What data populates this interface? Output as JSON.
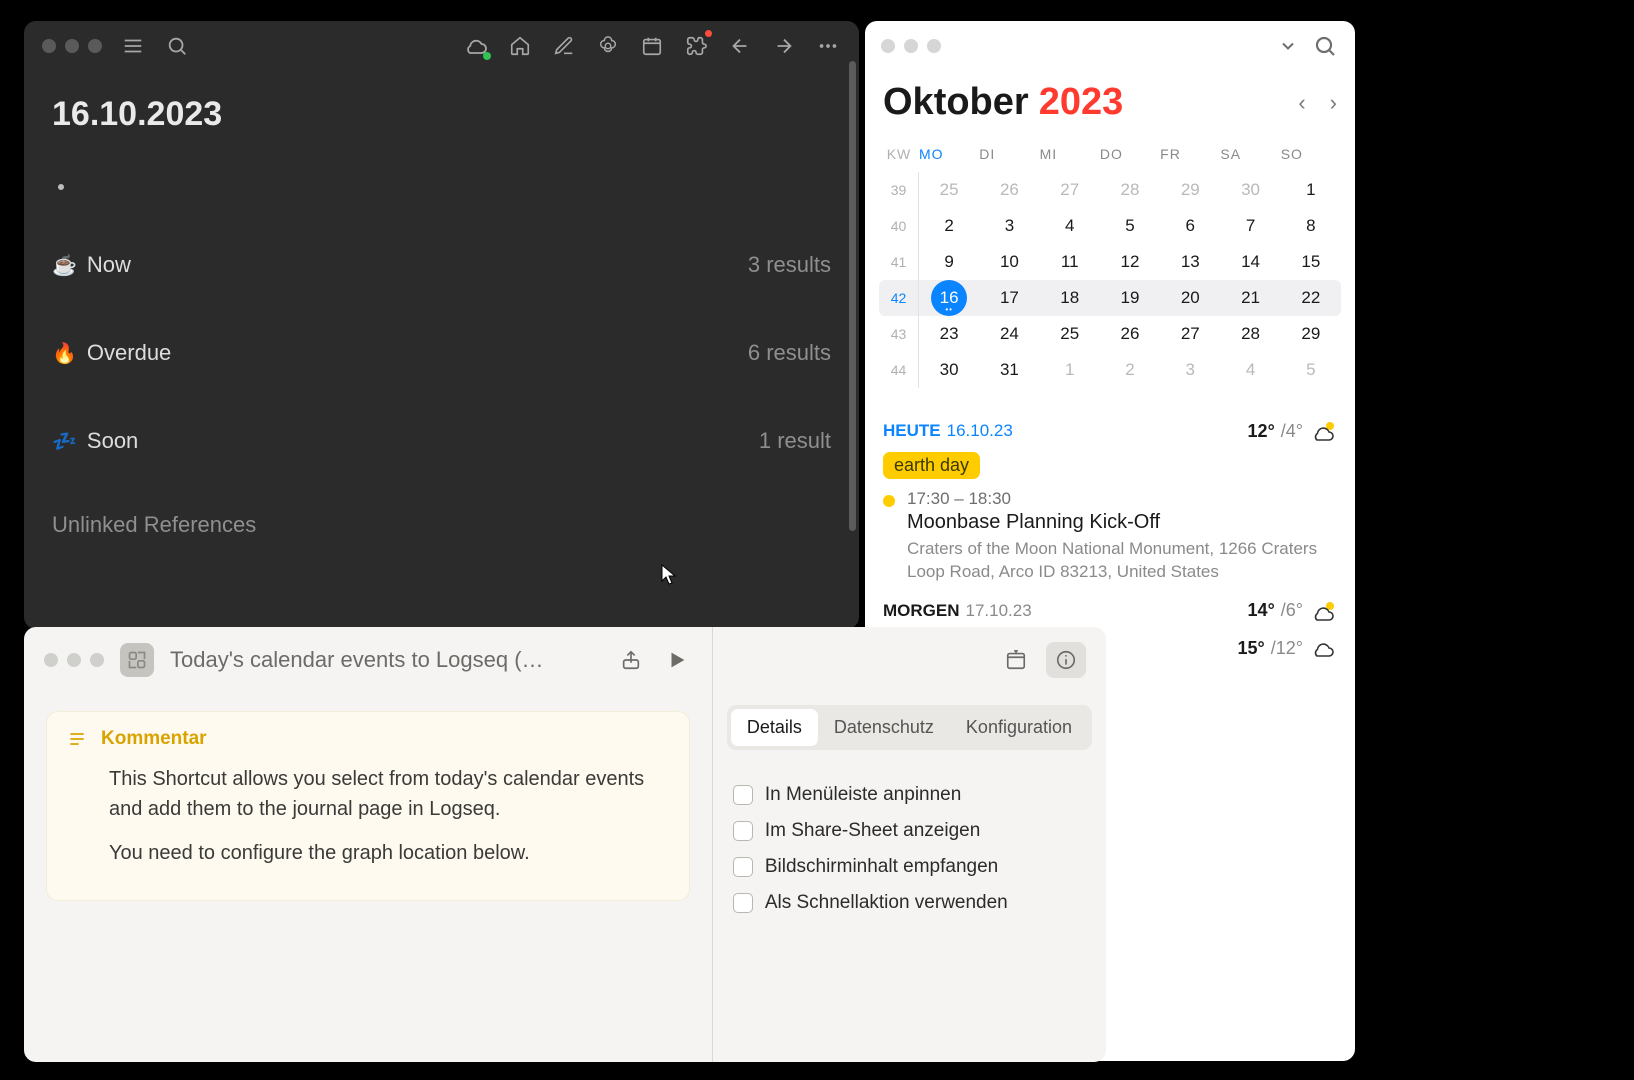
{
  "logseq": {
    "date_title": "16.10.2023",
    "sections": [
      {
        "emoji": "☕",
        "label": "Now",
        "count": "3 results"
      },
      {
        "emoji": "🔥",
        "label": "Overdue",
        "count": "6 results"
      },
      {
        "emoji": "💤",
        "label": "Soon",
        "count": "1 result"
      }
    ],
    "unlinked": "Unlinked References"
  },
  "calendar": {
    "month": "Oktober",
    "year": "2023",
    "weekday_kw": "KW",
    "weekdays": [
      "MO",
      "DI",
      "MI",
      "DO",
      "FR",
      "SA",
      "SO"
    ],
    "rows": [
      {
        "kw": "39",
        "days": [
          "25",
          "26",
          "27",
          "28",
          "29",
          "30",
          "1"
        ],
        "muted": [
          0,
          1,
          2,
          3,
          4,
          5
        ]
      },
      {
        "kw": "40",
        "days": [
          "2",
          "3",
          "4",
          "5",
          "6",
          "7",
          "8"
        ]
      },
      {
        "kw": "41",
        "days": [
          "9",
          "10",
          "11",
          "12",
          "13",
          "14",
          "15"
        ]
      },
      {
        "kw": "42",
        "days": [
          "16",
          "17",
          "18",
          "19",
          "20",
          "21",
          "22"
        ],
        "today": 0,
        "selected": true
      },
      {
        "kw": "43",
        "days": [
          "23",
          "24",
          "25",
          "26",
          "27",
          "28",
          "29"
        ]
      },
      {
        "kw": "44",
        "days": [
          "30",
          "31",
          "1",
          "2",
          "3",
          "4",
          "5"
        ],
        "muted": [
          2,
          3,
          4,
          5,
          6
        ]
      }
    ],
    "today_label": "HEUTE",
    "today_date": "16.10.23",
    "today_hi": "12°",
    "today_lo": "/4°",
    "allday_badge": "earth day",
    "event": {
      "time": "17:30 – 18:30",
      "title": "Moonbase Planning Kick-Off",
      "location": "Craters of the Moon National Monument, 1266 Craters Loop Road, Arco ID 83213, United States"
    },
    "tomorrow_label": "MORGEN",
    "tomorrow_date": "17.10.23",
    "tomorrow_hi": "14°",
    "tomorrow_lo": "/6°",
    "extra_hi": "15°",
    "extra_lo": "/12°"
  },
  "shortcuts": {
    "title": "Today's calendar events to Logseq (…",
    "comment_label": "Kommentar",
    "comment_p1": "This Shortcut allows you select from today's calendar events and add them to the journal page in Logseq.",
    "comment_p2": "You need to configure the graph location below.",
    "tabs": [
      "Details",
      "Datenschutz",
      "Konfiguration"
    ],
    "options": [
      "In Menüleiste anpinnen",
      "Im Share-Sheet anzeigen",
      "Bildschirminhalt empfangen",
      "Als Schnellaktion verwenden"
    ]
  }
}
